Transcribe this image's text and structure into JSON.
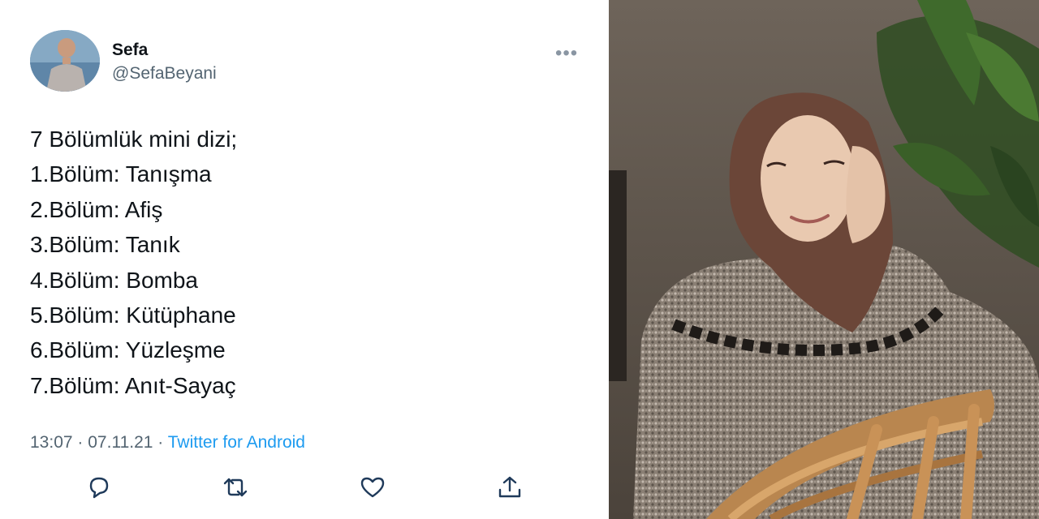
{
  "tweet": {
    "author_name": "Sefa",
    "author_handle": "@SefaBeyani",
    "lines": [
      "7 Bölümlük mini dizi;",
      "1.Bölüm: Tanışma",
      "2.Bölüm: Afiş",
      "3.Bölüm: Tanık",
      "4.Bölüm: Bomba",
      "5.Bölüm: Kütüphane",
      "6.Bölüm: Yüzleşme",
      "7.Bölüm: Anıt-Sayaç"
    ],
    "time": "13:07",
    "date": "07.11.21",
    "separator": "·",
    "source": "Twitter for Android",
    "actions": [
      "reply-icon",
      "retweet-icon",
      "like-icon",
      "share-icon"
    ],
    "more_icon": "more-options-icon"
  },
  "colors": {
    "text": "#0f1419",
    "secondary": "#536471",
    "link": "#1d9bf0",
    "icon": "#1f3a5a"
  }
}
